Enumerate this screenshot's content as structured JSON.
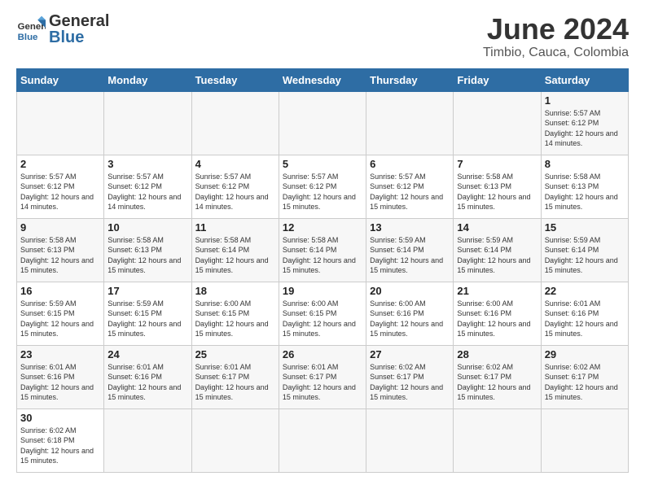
{
  "header": {
    "logo_general": "General",
    "logo_blue": "Blue",
    "month": "June 2024",
    "location": "Timbio, Cauca, Colombia"
  },
  "weekdays": [
    "Sunday",
    "Monday",
    "Tuesday",
    "Wednesday",
    "Thursday",
    "Friday",
    "Saturday"
  ],
  "weeks": [
    [
      {
        "day": "",
        "info": ""
      },
      {
        "day": "",
        "info": ""
      },
      {
        "day": "",
        "info": ""
      },
      {
        "day": "",
        "info": ""
      },
      {
        "day": "",
        "info": ""
      },
      {
        "day": "",
        "info": ""
      },
      {
        "day": "1",
        "info": "Sunrise: 5:57 AM\nSunset: 6:12 PM\nDaylight: 12 hours and 14 minutes."
      }
    ],
    [
      {
        "day": "2",
        "info": "Sunrise: 5:57 AM\nSunset: 6:12 PM\nDaylight: 12 hours and 14 minutes."
      },
      {
        "day": "3",
        "info": "Sunrise: 5:57 AM\nSunset: 6:12 PM\nDaylight: 12 hours and 14 minutes."
      },
      {
        "day": "4",
        "info": "Sunrise: 5:57 AM\nSunset: 6:12 PM\nDaylight: 12 hours and 14 minutes."
      },
      {
        "day": "5",
        "info": "Sunrise: 5:57 AM\nSunset: 6:12 PM\nDaylight: 12 hours and 15 minutes."
      },
      {
        "day": "6",
        "info": "Sunrise: 5:57 AM\nSunset: 6:12 PM\nDaylight: 12 hours and 15 minutes."
      },
      {
        "day": "7",
        "info": "Sunrise: 5:58 AM\nSunset: 6:13 PM\nDaylight: 12 hours and 15 minutes."
      },
      {
        "day": "8",
        "info": "Sunrise: 5:58 AM\nSunset: 6:13 PM\nDaylight: 12 hours and 15 minutes."
      }
    ],
    [
      {
        "day": "9",
        "info": "Sunrise: 5:58 AM\nSunset: 6:13 PM\nDaylight: 12 hours and 15 minutes."
      },
      {
        "day": "10",
        "info": "Sunrise: 5:58 AM\nSunset: 6:13 PM\nDaylight: 12 hours and 15 minutes."
      },
      {
        "day": "11",
        "info": "Sunrise: 5:58 AM\nSunset: 6:14 PM\nDaylight: 12 hours and 15 minutes."
      },
      {
        "day": "12",
        "info": "Sunrise: 5:58 AM\nSunset: 6:14 PM\nDaylight: 12 hours and 15 minutes."
      },
      {
        "day": "13",
        "info": "Sunrise: 5:59 AM\nSunset: 6:14 PM\nDaylight: 12 hours and 15 minutes."
      },
      {
        "day": "14",
        "info": "Sunrise: 5:59 AM\nSunset: 6:14 PM\nDaylight: 12 hours and 15 minutes."
      },
      {
        "day": "15",
        "info": "Sunrise: 5:59 AM\nSunset: 6:14 PM\nDaylight: 12 hours and 15 minutes."
      }
    ],
    [
      {
        "day": "16",
        "info": "Sunrise: 5:59 AM\nSunset: 6:15 PM\nDaylight: 12 hours and 15 minutes."
      },
      {
        "day": "17",
        "info": "Sunrise: 5:59 AM\nSunset: 6:15 PM\nDaylight: 12 hours and 15 minutes."
      },
      {
        "day": "18",
        "info": "Sunrise: 6:00 AM\nSunset: 6:15 PM\nDaylight: 12 hours and 15 minutes."
      },
      {
        "day": "19",
        "info": "Sunrise: 6:00 AM\nSunset: 6:15 PM\nDaylight: 12 hours and 15 minutes."
      },
      {
        "day": "20",
        "info": "Sunrise: 6:00 AM\nSunset: 6:16 PM\nDaylight: 12 hours and 15 minutes."
      },
      {
        "day": "21",
        "info": "Sunrise: 6:00 AM\nSunset: 6:16 PM\nDaylight: 12 hours and 15 minutes."
      },
      {
        "day": "22",
        "info": "Sunrise: 6:01 AM\nSunset: 6:16 PM\nDaylight: 12 hours and 15 minutes."
      }
    ],
    [
      {
        "day": "23",
        "info": "Sunrise: 6:01 AM\nSunset: 6:16 PM\nDaylight: 12 hours and 15 minutes."
      },
      {
        "day": "24",
        "info": "Sunrise: 6:01 AM\nSunset: 6:16 PM\nDaylight: 12 hours and 15 minutes."
      },
      {
        "day": "25",
        "info": "Sunrise: 6:01 AM\nSunset: 6:17 PM\nDaylight: 12 hours and 15 minutes."
      },
      {
        "day": "26",
        "info": "Sunrise: 6:01 AM\nSunset: 6:17 PM\nDaylight: 12 hours and 15 minutes."
      },
      {
        "day": "27",
        "info": "Sunrise: 6:02 AM\nSunset: 6:17 PM\nDaylight: 12 hours and 15 minutes."
      },
      {
        "day": "28",
        "info": "Sunrise: 6:02 AM\nSunset: 6:17 PM\nDaylight: 12 hours and 15 minutes."
      },
      {
        "day": "29",
        "info": "Sunrise: 6:02 AM\nSunset: 6:17 PM\nDaylight: 12 hours and 15 minutes."
      }
    ],
    [
      {
        "day": "30",
        "info": "Sunrise: 6:02 AM\nSunset: 6:18 PM\nDaylight: 12 hours and 15 minutes."
      },
      {
        "day": "",
        "info": ""
      },
      {
        "day": "",
        "info": ""
      },
      {
        "day": "",
        "info": ""
      },
      {
        "day": "",
        "info": ""
      },
      {
        "day": "",
        "info": ""
      },
      {
        "day": "",
        "info": ""
      }
    ]
  ]
}
